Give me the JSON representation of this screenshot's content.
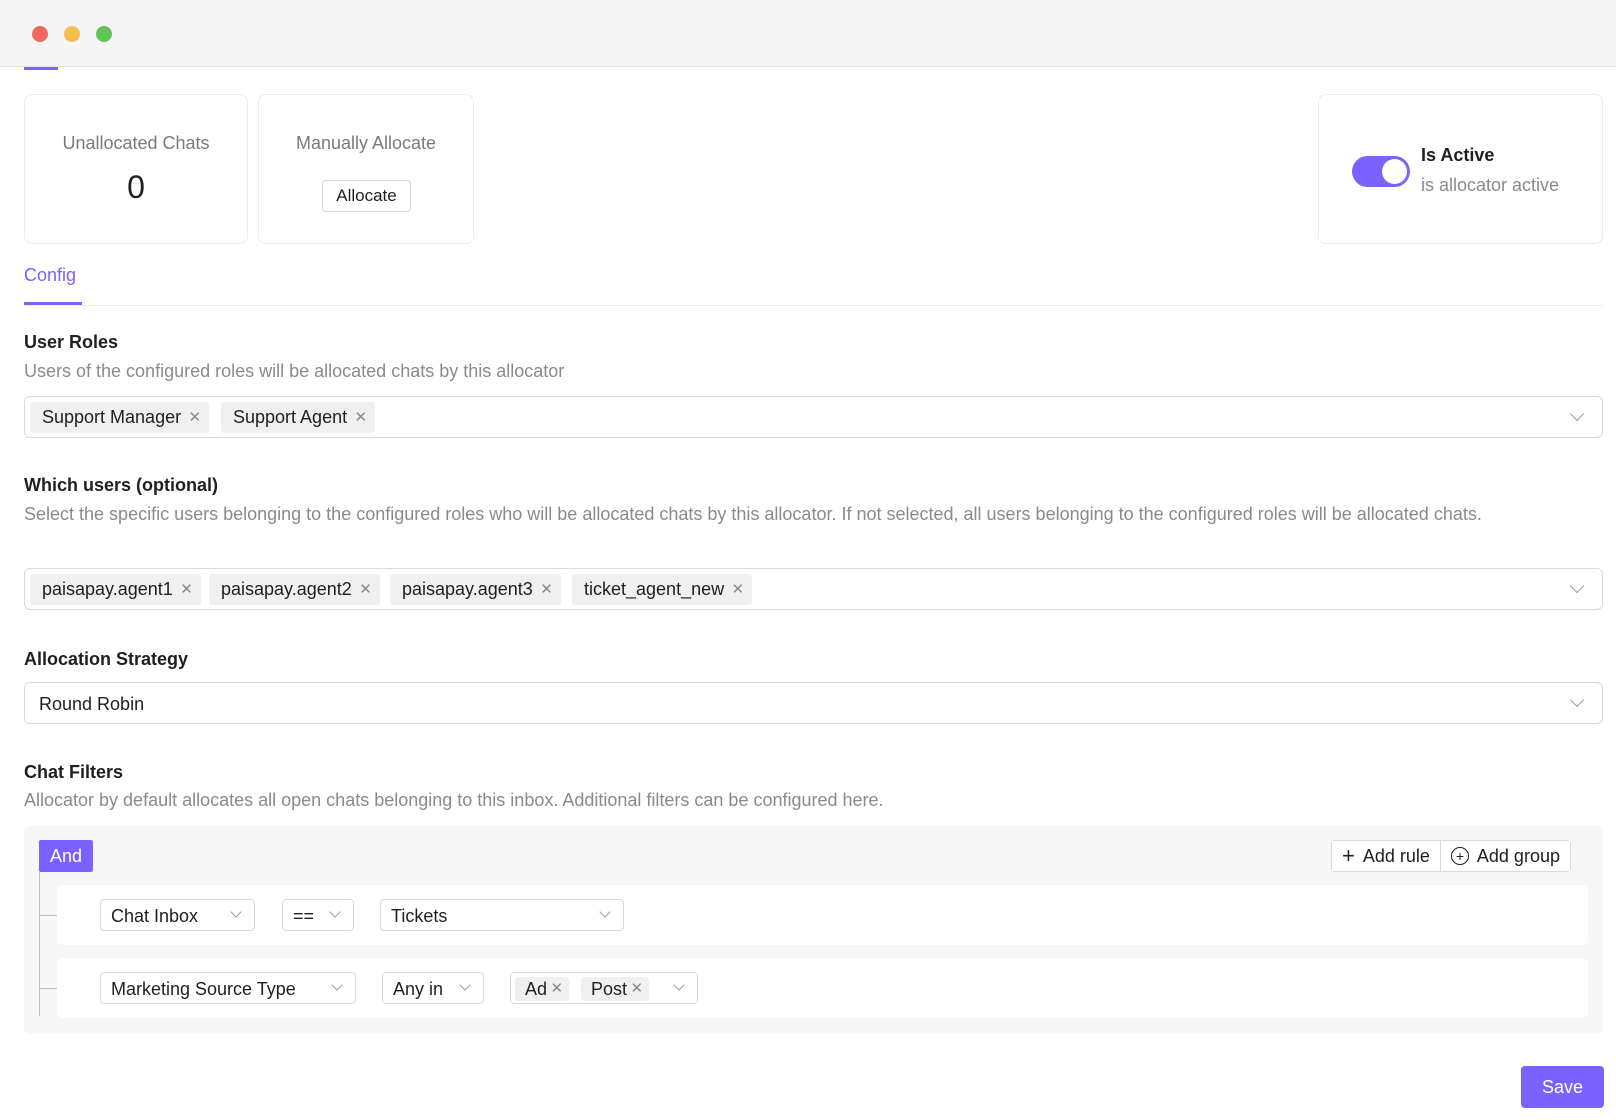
{
  "stats": {
    "unallocated_title": "Unallocated Chats",
    "unallocated_value": "0",
    "manual_title": "Manually Allocate",
    "allocate_label": "Allocate"
  },
  "status": {
    "is_active_label": "Is Active",
    "is_active_sub": "is allocator active",
    "is_active_on": true
  },
  "tabs": [
    {
      "label": "Config",
      "selected": true
    }
  ],
  "user_roles": {
    "label": "User Roles",
    "help": "Users of the configured roles will be allocated chats by this allocator",
    "selected": [
      "Support Manager",
      "Support Agent"
    ]
  },
  "which_users": {
    "label": "Which users (optional)",
    "help": "Select the specific users belonging to the configured roles who will be allocated chats by this allocator. If not selected, all users belonging to the configured roles will be allocated chats.",
    "selected": [
      "paisapay.agent1",
      "paisapay.agent2",
      "paisapay.agent3",
      "ticket_agent_new"
    ]
  },
  "strategy": {
    "label": "Allocation Strategy",
    "value": "Round Robin"
  },
  "chat_filters": {
    "label": "Chat Filters",
    "help": "Allocator by default allocates all open chats belonging to this inbox. Additional filters can be configured here.",
    "combinator": "And",
    "add_rule_label": "Add rule",
    "add_group_label": "Add group",
    "rules": [
      {
        "field": "Chat Inbox",
        "operator": "==",
        "value": "Tickets"
      },
      {
        "field": "Marketing Source Type",
        "operator": "Any in",
        "values": [
          "Ad",
          "Post"
        ]
      }
    ]
  },
  "save_label": "Save",
  "colors": {
    "accent": "#7b61ff",
    "tag_bg": "#f0f0f0",
    "muted_text": "#8a8a8a"
  }
}
